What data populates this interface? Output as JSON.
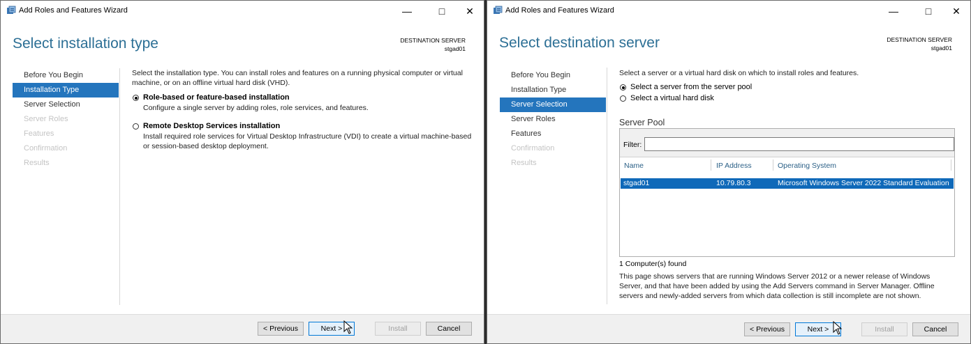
{
  "colors": {
    "accent": "#2475bd",
    "title": "#2c6f95",
    "selection": "#0f69b9"
  },
  "left": {
    "window_title": "Add Roles and Features Wizard",
    "page_title": "Select installation type",
    "destination_label": "DESTINATION SERVER",
    "destination_value": "stgad01",
    "nav": [
      "Before You Begin",
      "Installation Type",
      "Server Selection",
      "Server Roles",
      "Features",
      "Confirmation",
      "Results"
    ],
    "description": "Select the installation type. You can install roles and features on a running physical computer or virtual machine, or on an offline virtual hard disk (VHD).",
    "option1": {
      "label": "Role-based or feature-based installation",
      "desc": "Configure a single server by adding roles, role services, and features."
    },
    "option2": {
      "label": "Remote Desktop Services installation",
      "desc": "Install required role services for Virtual Desktop Infrastructure (VDI) to create a virtual machine-based or session-based desktop deployment."
    },
    "buttons": {
      "previous": "< Previous",
      "next": "Next >",
      "install": "Install",
      "cancel": "Cancel"
    }
  },
  "right": {
    "window_title": "Add Roles and Features Wizard",
    "page_title": "Select destination server",
    "destination_label": "DESTINATION SERVER",
    "destination_value": "stgad01",
    "nav": [
      "Before You Begin",
      "Installation Type",
      "Server Selection",
      "Server Roles",
      "Features",
      "Confirmation",
      "Results"
    ],
    "description": "Select a server or a virtual hard disk on which to install roles and features.",
    "option1": "Select a server from the server pool",
    "option2": "Select a virtual hard disk",
    "pool_label": "Server Pool",
    "filter_label": "Filter:",
    "filter_value": "",
    "columns": [
      "Name",
      "IP Address",
      "Operating System"
    ],
    "row": {
      "name": "stgad01",
      "ip": "10.79.80.3",
      "os": "Microsoft Windows Server 2022 Standard Evaluation"
    },
    "found": "1 Computer(s) found",
    "note": "This page shows servers that are running Windows Server 2012 or a newer release of Windows Server, and that have been added by using the Add Servers command in Server Manager. Offline servers and newly-added servers from which data collection is still incomplete are not shown.",
    "buttons": {
      "previous": "< Previous",
      "next": "Next >",
      "install": "Install",
      "cancel": "Cancel"
    }
  }
}
